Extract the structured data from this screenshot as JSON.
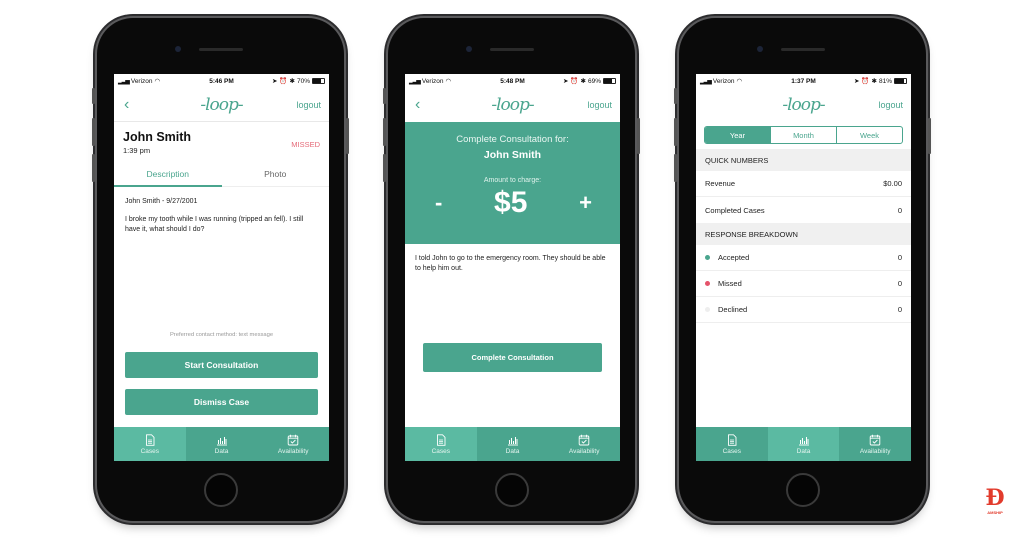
{
  "brand": {
    "logo": "-loop-",
    "accent": "#4aa58e",
    "missed_color": "#e56a78",
    "declined_color": "#eeeeee"
  },
  "nav": {
    "back": "‹",
    "logout": "logout"
  },
  "tabbar": {
    "tabs": [
      {
        "label": "Cases",
        "icon": "document-icon"
      },
      {
        "label": "Data",
        "icon": "bar-chart-icon"
      },
      {
        "label": "Availability",
        "icon": "calendar-check-icon"
      }
    ]
  },
  "screens": [
    {
      "status": {
        "carrier": "Verizon",
        "time": "5:46 PM",
        "battery": "70%",
        "battery_level": 0.7
      },
      "case": {
        "patient_name": "John Smith",
        "time": "1:39 pm",
        "status": "MISSED",
        "tabs": [
          "Description",
          "Photo"
        ],
        "dob_line": "John Smith - 9/27/2001",
        "description": "I broke my tooth while I was running (tripped an fell). I still have it, what should I do?",
        "preferred_contact": "Preferred contact method: text message",
        "start_button": "Start Consultation",
        "dismiss_button": "Dismiss Case"
      },
      "active_tab": 0
    },
    {
      "status": {
        "carrier": "Verizon",
        "time": "5:48 PM",
        "battery": "69%",
        "battery_level": 0.69
      },
      "consult": {
        "title": "Complete Consultation for:",
        "patient_name": "John Smith",
        "amount_label": "Amount to charge:",
        "minus": "-",
        "amount": "$5",
        "plus": "+",
        "note": "I told John to go to the emergency room. They should be able to help him out.",
        "complete_button": "Complete Consultation"
      },
      "active_tab": 0
    },
    {
      "status": {
        "carrier": "Verizon",
        "time": "1:37 PM",
        "battery": "81%",
        "battery_level": 0.81
      },
      "data": {
        "periods": [
          "Year",
          "Month",
          "Week"
        ],
        "active_period": "Year",
        "quick_numbers_header": "QUICK NUMBERS",
        "quick_numbers": [
          {
            "label": "Revenue",
            "value": "$0.00"
          },
          {
            "label": "Completed Cases",
            "value": "0"
          }
        ],
        "breakdown_header": "RESPONSE BREAKDOWN",
        "breakdown": [
          {
            "label": "Accepted",
            "value": "0",
            "color": "#4aa58e"
          },
          {
            "label": "Missed",
            "value": "0",
            "color": "#e5536a"
          },
          {
            "label": "Declined",
            "value": "0",
            "color": "#eeeeee"
          }
        ]
      },
      "active_tab": 1
    }
  ],
  "watermark": {
    "text": "AMSHIP"
  }
}
